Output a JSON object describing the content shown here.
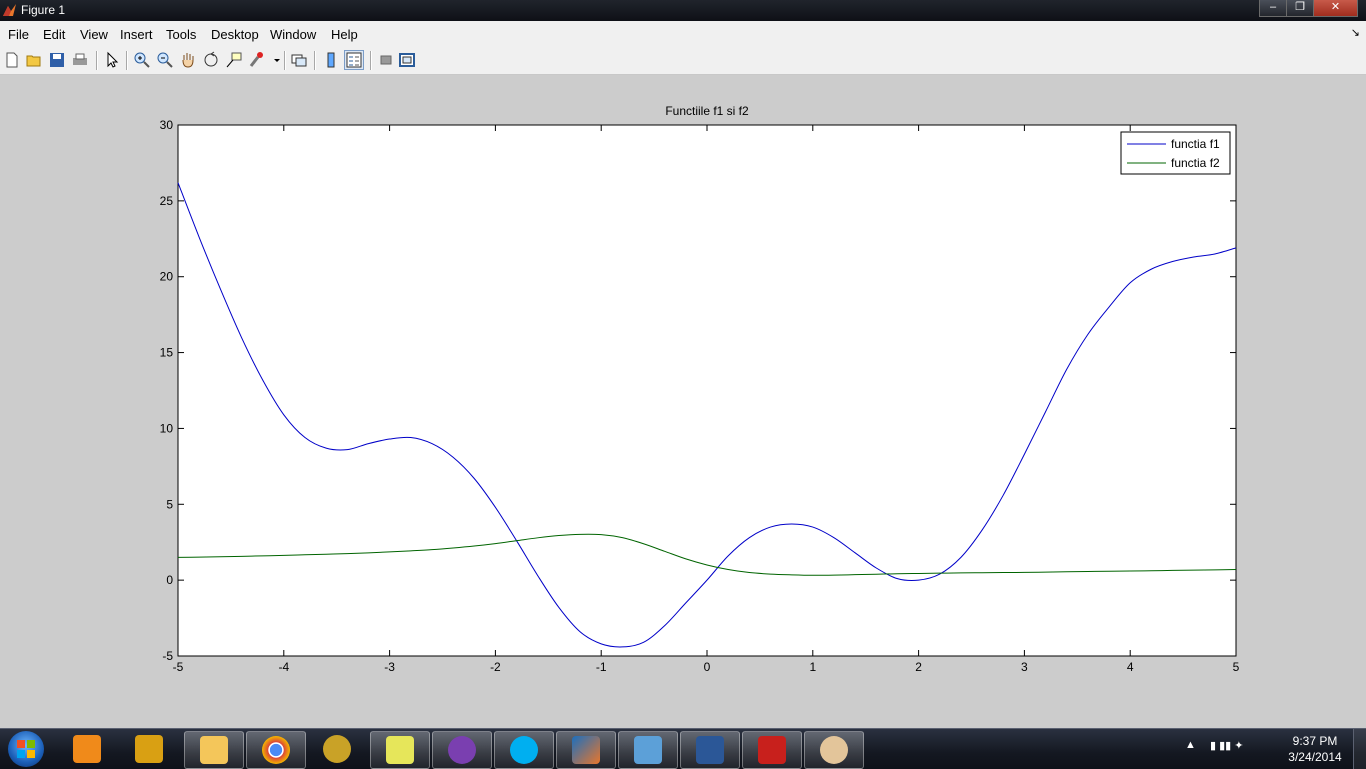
{
  "window": {
    "title": "Figure 1",
    "minimize": "–",
    "maximize": "❐",
    "close": "✕"
  },
  "menu": [
    "File",
    "Edit",
    "View",
    "Insert",
    "Tools",
    "Desktop",
    "Window",
    "Help"
  ],
  "menu_dock": "↘",
  "toolbar": [
    "new-figure-icon",
    "open-file-icon",
    "save-icon",
    "print-icon",
    "edit-plot-arrow-icon",
    "zoom-in-icon",
    "zoom-out-icon",
    "pan-hand-icon",
    "rotate-3d-icon",
    "data-cursor-icon",
    "brush-icon",
    "link-plot-icon",
    "insert-colorbar-icon",
    "insert-legend-icon",
    "hide-plot-tools-icon",
    "show-plot-tools-icon"
  ],
  "chart_data": {
    "type": "line",
    "title": "Functiile f1 si f2",
    "xlabel": "",
    "ylabel": "",
    "xlim": [
      -5,
      5
    ],
    "ylim": [
      -5,
      30
    ],
    "xticks": [
      "-5",
      "-4",
      "-3",
      "-2",
      "-1",
      "0",
      "1",
      "2",
      "3",
      "4",
      "5"
    ],
    "yticks": [
      "-5",
      "0",
      "5",
      "10",
      "15",
      "20",
      "25",
      "30"
    ],
    "grid": false,
    "legend_position": "top-right",
    "x": [
      -5,
      -4.8,
      -4.6,
      -4.4,
      -4.2,
      -4,
      -3.8,
      -3.6,
      -3.4,
      -3.2,
      -3,
      -2.8,
      -2.6,
      -2.4,
      -2.2,
      -2,
      -1.8,
      -1.6,
      -1.4,
      -1.2,
      -1,
      -0.8,
      -0.6,
      -0.4,
      -0.2,
      0,
      0.2,
      0.4,
      0.6,
      0.8,
      1,
      1.2,
      1.4,
      1.6,
      1.8,
      2,
      2.2,
      2.4,
      2.6,
      2.8,
      3,
      3.2,
      3.4,
      3.6,
      3.8,
      4,
      4.2,
      4.4,
      4.6,
      4.8,
      5
    ],
    "series": [
      {
        "name": "functia f1",
        "color": "#0000c8",
        "values": [
          26.2,
          22.6,
          19.2,
          16.0,
          13.2,
          10.9,
          9.4,
          8.7,
          8.6,
          9.0,
          9.3,
          9.4,
          9.0,
          8.1,
          6.7,
          4.8,
          2.6,
          0.3,
          -1.8,
          -3.4,
          -4.2,
          -4.4,
          -4.1,
          -3.0,
          -1.5,
          0.0,
          1.6,
          2.8,
          3.5,
          3.7,
          3.5,
          2.8,
          1.8,
          0.8,
          0.1,
          0.0,
          0.4,
          1.5,
          3.3,
          5.6,
          8.3,
          11.1,
          13.9,
          16.2,
          18.0,
          19.6,
          20.5,
          21.0,
          21.3,
          21.5,
          21.9
        ]
      },
      {
        "name": "functia f2",
        "color": "#006400",
        "values": [
          1.5,
          1.52,
          1.54,
          1.57,
          1.6,
          1.63,
          1.67,
          1.71,
          1.75,
          1.8,
          1.86,
          1.93,
          2.01,
          2.12,
          2.25,
          2.41,
          2.6,
          2.79,
          2.94,
          3.02,
          3.0,
          2.8,
          2.4,
          1.9,
          1.4,
          1.0,
          0.7,
          0.5,
          0.4,
          0.35,
          0.32,
          0.33,
          0.36,
          0.39,
          0.42,
          0.44,
          0.46,
          0.48,
          0.49,
          0.5,
          0.51,
          0.53,
          0.55,
          0.57,
          0.59,
          0.6,
          0.62,
          0.64,
          0.66,
          0.68,
          0.7
        ]
      }
    ]
  },
  "taskbar": {
    "apps": [
      "media-player-icon",
      "winamp-icon",
      "file-explorer-icon",
      "chrome-icon",
      "media-center-icon",
      "sticky-notes-icon",
      "bittorrent-icon",
      "skype-icon",
      "matlab-icon",
      "photo-viewer-icon",
      "word-icon",
      "acrobat-icon",
      "paint-icon"
    ],
    "tray": "▲",
    "time": "9:37 PM",
    "date": "3/24/2014"
  }
}
